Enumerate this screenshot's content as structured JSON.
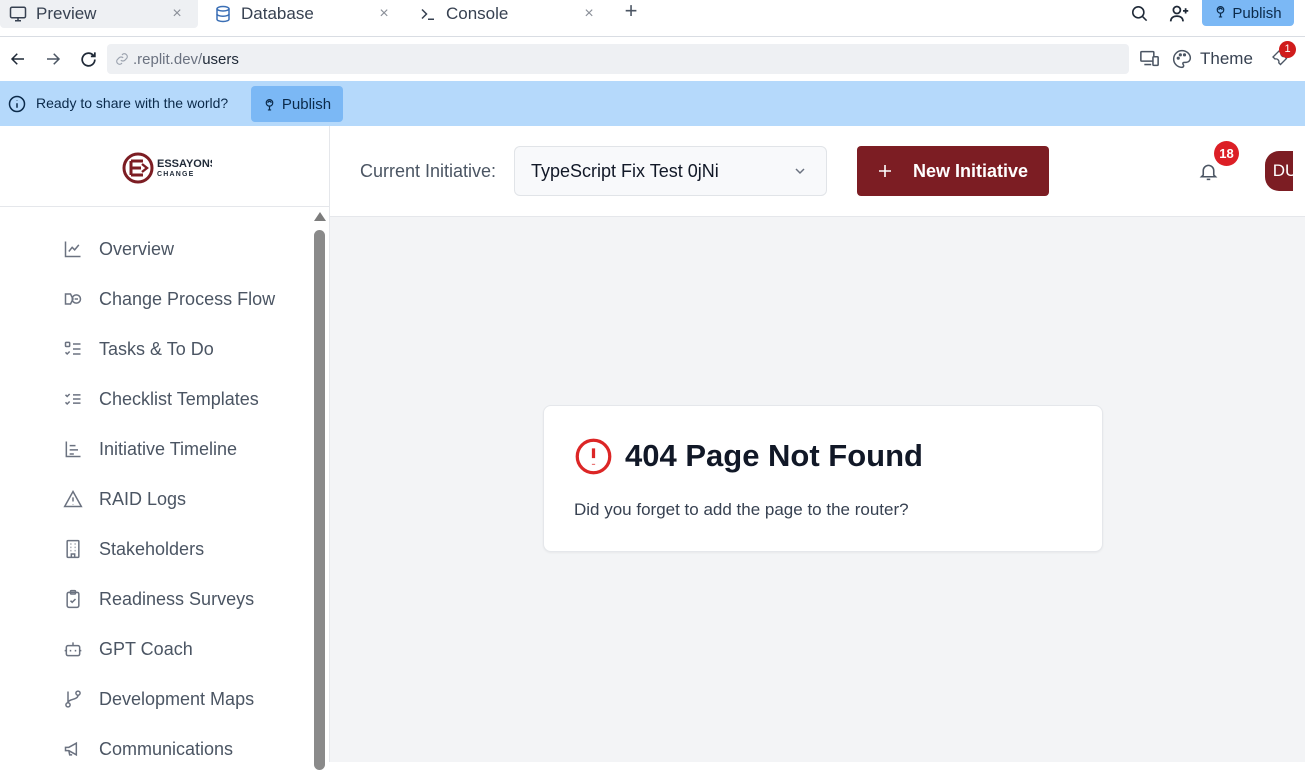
{
  "browser": {
    "tabs": [
      {
        "label": "Preview",
        "icon": "monitor-icon",
        "active": true
      },
      {
        "label": "Database",
        "icon": "database-icon",
        "active": false
      },
      {
        "label": "Console",
        "icon": "terminal-icon",
        "active": false
      }
    ],
    "publish_label": "Publish",
    "url_host": ".replit.dev/",
    "url_path": "users",
    "theme_label": "Theme",
    "tools_badge": "1"
  },
  "banner": {
    "text": "Ready to share with the world?",
    "publish_label": "Publish"
  },
  "sidebar": {
    "items": [
      {
        "label": "Overview",
        "icon": "chart-line-icon"
      },
      {
        "label": "Change Process Flow",
        "icon": "process-flow-icon"
      },
      {
        "label": "Tasks & To Do",
        "icon": "list-todo-icon"
      },
      {
        "label": "Checklist Templates",
        "icon": "list-checks-icon"
      },
      {
        "label": "Initiative Timeline",
        "icon": "timeline-icon"
      },
      {
        "label": "RAID Logs",
        "icon": "alert-triangle-icon"
      },
      {
        "label": "Stakeholders",
        "icon": "building-icon"
      },
      {
        "label": "Readiness Surveys",
        "icon": "clipboard-check-icon"
      },
      {
        "label": "GPT Coach",
        "icon": "bot-icon"
      },
      {
        "label": "Development Maps",
        "icon": "git-branch-icon"
      },
      {
        "label": "Communications",
        "icon": "megaphone-icon"
      }
    ]
  },
  "header": {
    "current_label": "Current Initiative:",
    "selected_initiative": "TypeScript Fix Test 0jNi",
    "new_initiative_label": "New Initiative",
    "notification_count": "18",
    "avatar_initials": "DU"
  },
  "main": {
    "title": "404 Page Not Found",
    "description": "Did you forget to add the page to the router?"
  },
  "colors": {
    "brand": "#7c1d23",
    "banner": "#b5d9fb",
    "publish": "#7bb8f5",
    "badge": "#dc1f26"
  }
}
